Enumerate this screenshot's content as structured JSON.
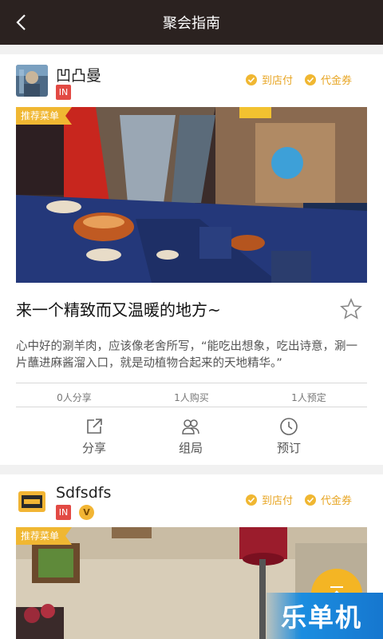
{
  "header": {
    "title": "聚会指南",
    "back_icon": "chevron-left-icon"
  },
  "colors": {
    "header_bg": "#2b2220",
    "accent": "#f0b732",
    "badge_in": "#e24a44"
  },
  "posts": [
    {
      "shop_name": "凹凸曼",
      "badges": [
        "IN"
      ],
      "tags": [
        "到店付",
        "代金券"
      ],
      "ribbon": "推荐菜单",
      "title": "来一个精致而又温暖的地方~",
      "description": "心中好的涮羊肉，应该像老舍所写，“能吃出想象，吃出诗意，涮一片蘸进麻酱溜入口，就是动植物合起来的天地精华。”",
      "stats": [
        "0人分享",
        "1人购买",
        "1人预定"
      ],
      "actions": [
        {
          "label": "分享",
          "icon": "share-icon"
        },
        {
          "label": "组局",
          "icon": "group-icon"
        },
        {
          "label": "预订",
          "icon": "clock-icon"
        }
      ]
    },
    {
      "shop_name": "Sdfsdfs",
      "badges": [
        "IN",
        "V"
      ],
      "tags": [
        "到店付",
        "代金券"
      ],
      "ribbon": "推荐菜单"
    }
  ],
  "fab": {
    "icon": "scroll-to-top-icon"
  },
  "watermark": "乐单机"
}
